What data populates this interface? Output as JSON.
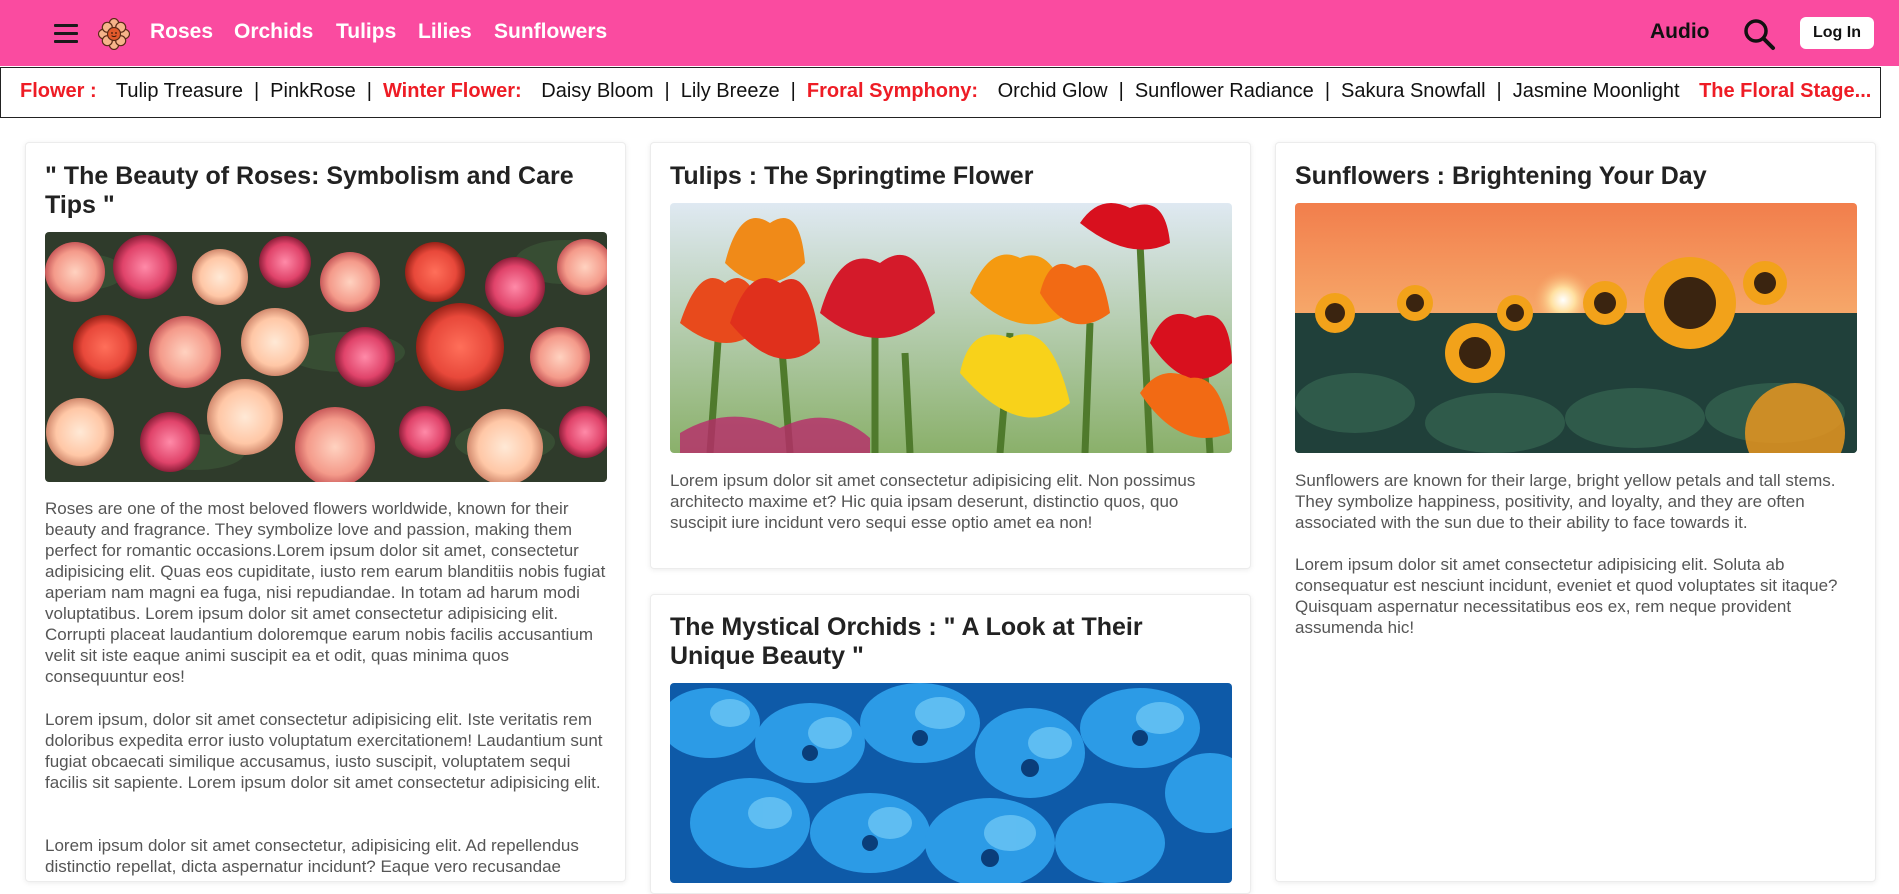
{
  "nav": {
    "links": [
      "Roses",
      "Orchids",
      "Tulips",
      "Lilies",
      "Sunflowers"
    ],
    "audio_label": "Audio",
    "login_label": "Log In",
    "menu_icon": "hamburger-icon",
    "logo_icon": "flower-logo",
    "search_icon": "search-icon"
  },
  "ticker": {
    "cat1": "Flower :",
    "item1": "Tulip Treasure",
    "item2": "PinkRose",
    "cat2": "Winter Flower:",
    "item3": "Daisy Bloom",
    "item4": "Lily Breeze",
    "cat3": "Froral Symphony:",
    "item5": "Orchid Glow",
    "item6": "Sunflower Radiance",
    "item7": "Sakura Snowfall",
    "item8": "Jasmine Moonlight",
    "cat4": "The Floral Stage...",
    "separator": "|"
  },
  "cards": {
    "roses": {
      "title": "\" The Beauty of Roses: Symbolism and Care Tips \"",
      "p1": "Roses are one of the most beloved flowers worldwide, known for their beauty and fragrance. They symbolize love and passion, making them perfect for romantic occasions.Lorem ipsum dolor sit amet, consectetur adipisicing elit. Quas eos cupiditate, iusto rem earum blanditiis nobis fugiat aperiam nam magni ea fuga, nisi repudiandae. In totam ad harum modi voluptatibus. Lorem ipsum dolor sit amet consectetur adipisicing elit. Corrupti placeat laudantium doloremque earum nobis facilis accusantium velit sit iste eaque animi suscipit ea et odit, quas minima quos consequuntur eos!",
      "p2": "Lorem ipsum, dolor sit amet consectetur adipisicing elit. Iste veritatis rem doloribus expedita error iusto voluptatum exercitationem! Laudantium sunt fugiat obcaecati similique accusamus, iusto suscipit, voluptatem sequi facilis sit sapiente. Lorem ipsum dolor sit amet consectetur adipisicing elit.",
      "p3": "Lorem ipsum dolor sit amet consectetur, adipisicing elit. Ad repellendus distinctio repellat, dicta aspernatur incidunt? Eaque vero recusandae"
    },
    "tulips": {
      "title": "Tulips : The Springtime Flower",
      "p1": "Lorem ipsum dolor sit amet consectetur adipisicing elit. Non possimus architecto maxime et? Hic quia ipsam deserunt, distinctio quos, quo suscipit iure incidunt vero sequi esse optio amet ea non!"
    },
    "orchids": {
      "title": "The Mystical Orchids : \" A Look at Their Unique Beauty \""
    },
    "sunflowers": {
      "title": "Sunflowers : Brightening Your Day",
      "p1": "Sunflowers are known for their large, bright yellow petals and tall stems. They symbolize happiness, positivity, and loyalty, and they are often associated with the sun due to their ability to face towards it.",
      "p2": "Lorem ipsum dolor sit amet consectetur adipisicing elit. Soluta ab consequatur est nesciunt incidunt, eveniet et quod voluptates sit itaque? Quisquam aspernatur necessitatibus eos ex, rem neque provident assumenda hic!"
    }
  },
  "colors": {
    "nav_bg": "#fa4ba0",
    "ticker_category": "#ee1c25",
    "body_text": "#555555",
    "title_text": "#222222"
  }
}
